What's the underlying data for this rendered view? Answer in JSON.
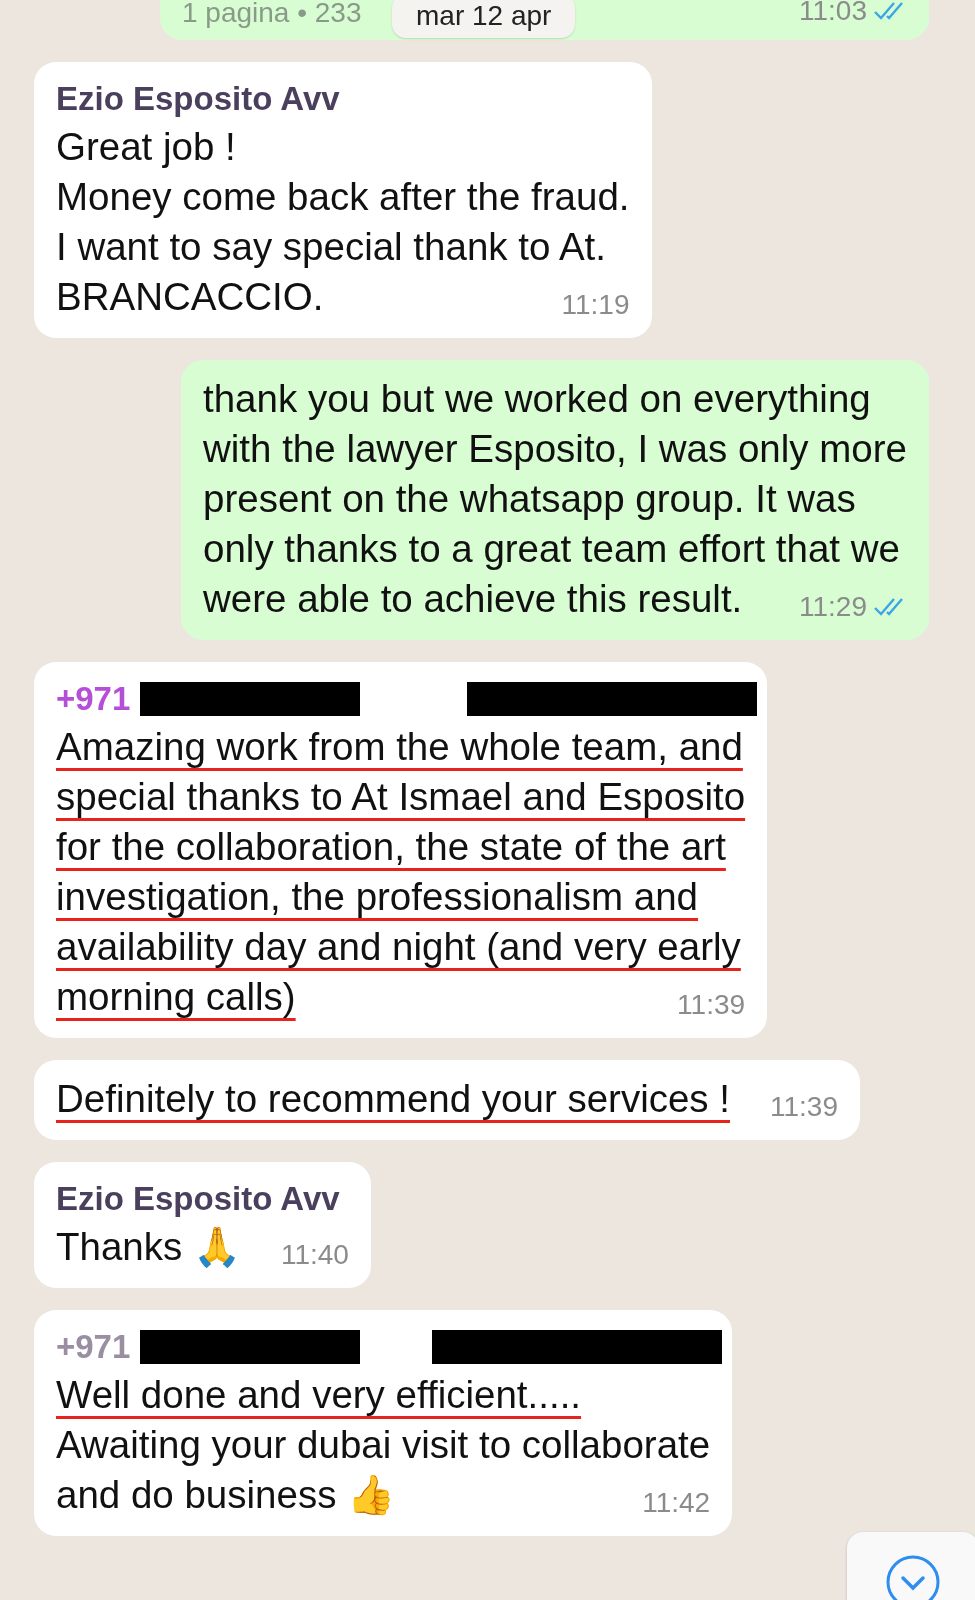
{
  "date_label": "mar 12 apr",
  "messages": [
    {
      "kind": "outgoing",
      "lines": [
        {
          "text": "1 pagina • 233"
        }
      ],
      "time": "11:03",
      "read": true,
      "muted": true
    },
    {
      "kind": "incoming",
      "sender": {
        "name": "Ezio Esposito Avv",
        "color": "#4a3f5c"
      },
      "lines": [
        {
          "text": "Great job !",
          "underlined": false
        },
        {
          "text": "Money come back after the fraud.",
          "underlined": false
        },
        {
          "text": "I want to say special thank to At.",
          "underlined": false
        },
        {
          "text": "BRANCACCIO.",
          "underlined": false
        }
      ],
      "time": "11:19"
    },
    {
      "kind": "outgoing",
      "lines": [
        {
          "text": "thank you but we worked on everything",
          "underlined": false
        },
        {
          "text": "with the lawyer Esposito, I was only more",
          "underlined": false
        },
        {
          "text": "present on the whatsapp group. It was",
          "underlined": false
        },
        {
          "text": "only thanks to a great team effort that we",
          "underlined": false
        },
        {
          "text": "were able to achieve this result.",
          "underlined": false
        }
      ],
      "time": "11:29",
      "read": true,
      "muted": false
    },
    {
      "kind": "incoming",
      "sender": {
        "name": "+971",
        "color": "#b64fd8",
        "redacted": true
      },
      "lines": [
        {
          "text": "Amazing work from the whole team, and",
          "underlined": true
        },
        {
          "text": "special thanks to At Ismael and Esposito",
          "underlined": true
        },
        {
          "text": "for the collaboration, the state of the art",
          "underlined": true
        },
        {
          "text": "investigation, the professionalism and",
          "underlined": true
        },
        {
          "text": "availability day and night (and very early",
          "underlined": true
        },
        {
          "text": "morning calls)",
          "underlined": true
        }
      ],
      "time": "11:39"
    },
    {
      "kind": "incoming",
      "lines": [
        {
          "text": "Definitely to recommend your services !",
          "underlined": true
        }
      ],
      "time": "11:39"
    },
    {
      "kind": "incoming",
      "sender": {
        "name": "Ezio Esposito Avv",
        "color": "#4a3f5c"
      },
      "lines": [
        {
          "text": "Thanks 🙏",
          "underlined": false
        }
      ],
      "time": "11:40"
    },
    {
      "kind": "incoming",
      "sender": {
        "name": "+971",
        "color": "#9a8ea3",
        "redacted": true
      },
      "lines": [
        {
          "text": "Well done and very efficient.....",
          "underlined": true
        },
        {
          "text": "Awaiting your dubai visit to collaborate",
          "underlined": false
        },
        {
          "text": "and do business 👍",
          "underlined": false
        }
      ],
      "time": "11:42"
    }
  ]
}
